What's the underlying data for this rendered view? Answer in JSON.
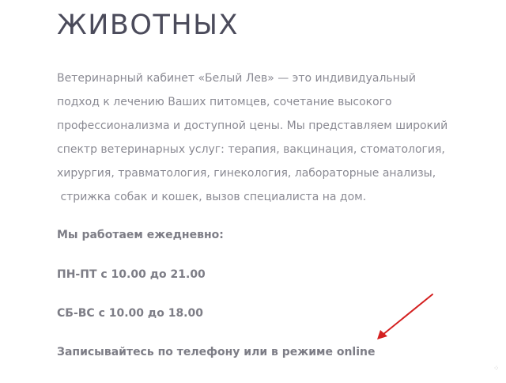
{
  "heading": "ЖИВОТНЫХ",
  "intro_lines": [
    "Ветеринарный кабинет «Белый Лев» — это индивидуальный",
    "подход к лечению Ваших питомцев, сочетание высокого",
    "профессионализма и доступной цены. Мы представляем широкий",
    "спектр ветеринарных услуг: терапия, вакцинация, стоматология,",
    "хирургия, травматология, гинекология, лабораторные анализы,",
    " стрижка собак и кошек, вызов специалиста на дом."
  ],
  "schedule": {
    "title": "Мы работаем ежедневно:",
    "weekdays": "ПН-ПТ с 10.00 до 21.00",
    "weekend": "СБ-ВС с 10.00 до 18.00"
  },
  "booking_text": "Записывайтесь по телефону или в режиме online",
  "annotation": {
    "arrow_color": "#d42020"
  },
  "corner_glyph": "⁘"
}
